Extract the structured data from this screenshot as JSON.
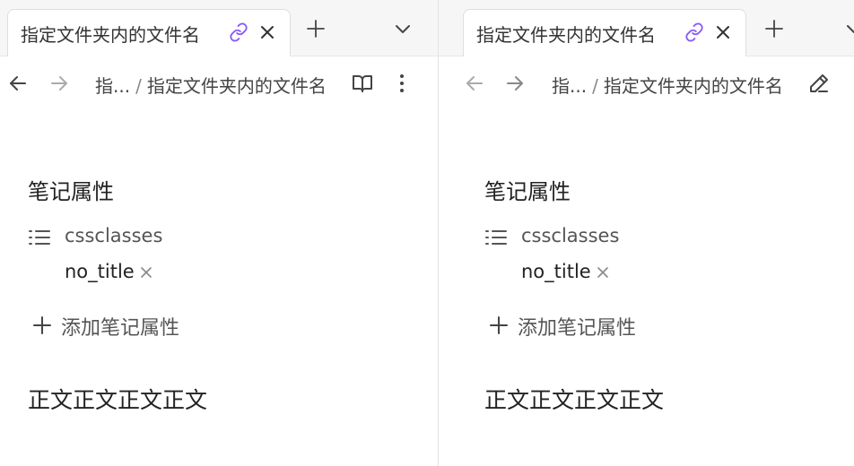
{
  "panes": [
    {
      "tab": {
        "title": "指定文件夹内的文件名"
      },
      "breadcrumb": {
        "parent": "指...",
        "separator": "/",
        "current": "指定文件夹内的文件名"
      },
      "view_mode_icon": "book-open-icon",
      "properties": {
        "heading": "笔记属性",
        "key": "cssclasses",
        "value": "no_title",
        "add_label": "添加笔记属性"
      },
      "body": "正文正文正文正文"
    },
    {
      "tab": {
        "title": "指定文件夹内的文件名"
      },
      "breadcrumb": {
        "parent": "指...",
        "separator": "/",
        "current": "指定文件夹内的文件名"
      },
      "view_mode_icon": "pencil-icon",
      "properties": {
        "heading": "笔记属性",
        "key": "cssclasses",
        "value": "no_title",
        "add_label": "添加笔记属性"
      },
      "body": "正文正文正文正文"
    }
  ],
  "colors": {
    "link_icon": "#8a5cf5",
    "divider": "#e3e3e3",
    "tabbar_bg": "#f6f6f6"
  }
}
